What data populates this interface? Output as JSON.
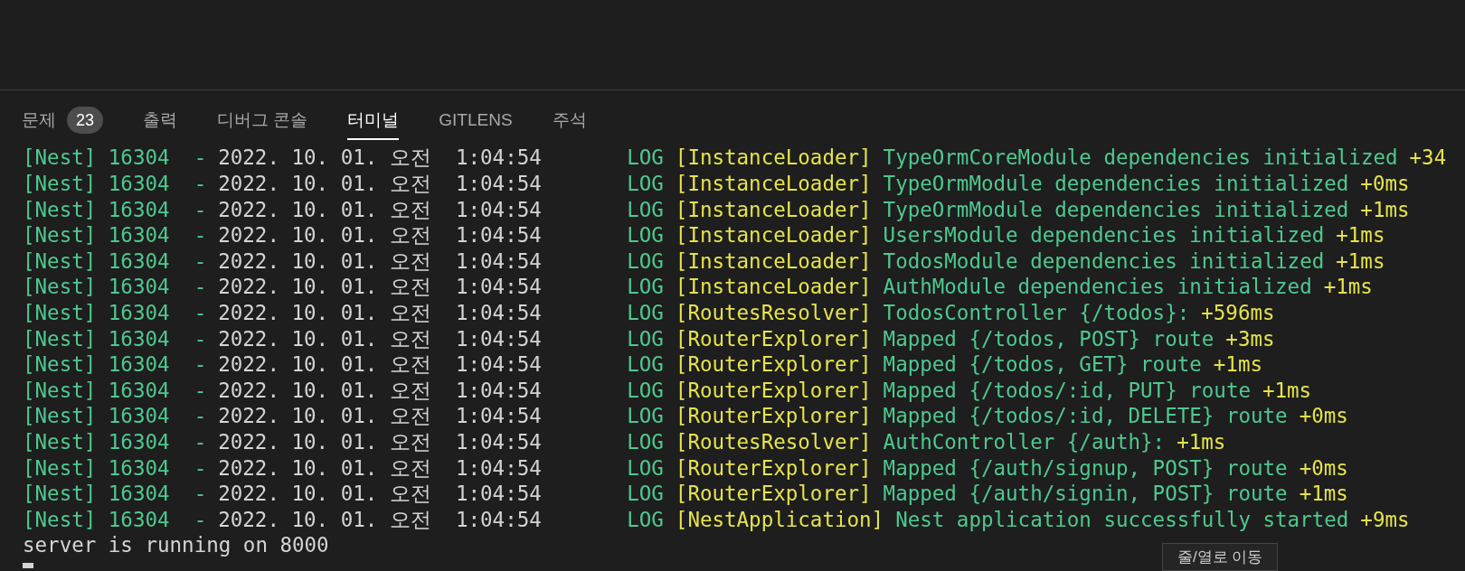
{
  "panel": {
    "tabs": [
      {
        "label": "문제",
        "badge": "23",
        "selected": false
      },
      {
        "label": "출력",
        "selected": false
      },
      {
        "label": "디버그 콘솔",
        "selected": false
      },
      {
        "label": "터미널",
        "selected": true
      },
      {
        "label": "GITLENS",
        "selected": false
      },
      {
        "label": "주석",
        "selected": false
      }
    ]
  },
  "terminal": {
    "lines": [
      {
        "kind": "log",
        "source": "[Nest] 16304  -",
        "timestamp": "2022. 10. 01. 오전  1:04:54",
        "log_level": "LOG",
        "context": "[InstanceLoader]",
        "message": "TypeOrmCoreModule dependencies initialized",
        "elapsed": "+34"
      },
      {
        "kind": "log",
        "source": "[Nest] 16304  -",
        "timestamp": "2022. 10. 01. 오전  1:04:54",
        "log_level": "LOG",
        "context": "[InstanceLoader]",
        "message": "TypeOrmModule dependencies initialized",
        "elapsed": "+0ms"
      },
      {
        "kind": "log",
        "source": "[Nest] 16304  -",
        "timestamp": "2022. 10. 01. 오전  1:04:54",
        "log_level": "LOG",
        "context": "[InstanceLoader]",
        "message": "TypeOrmModule dependencies initialized",
        "elapsed": "+1ms"
      },
      {
        "kind": "log",
        "source": "[Nest] 16304  -",
        "timestamp": "2022. 10. 01. 오전  1:04:54",
        "log_level": "LOG",
        "context": "[InstanceLoader]",
        "message": "UsersModule dependencies initialized",
        "elapsed": "+1ms"
      },
      {
        "kind": "log",
        "source": "[Nest] 16304  -",
        "timestamp": "2022. 10. 01. 오전  1:04:54",
        "log_level": "LOG",
        "context": "[InstanceLoader]",
        "message": "TodosModule dependencies initialized",
        "elapsed": "+1ms"
      },
      {
        "kind": "log",
        "source": "[Nest] 16304  -",
        "timestamp": "2022. 10. 01. 오전  1:04:54",
        "log_level": "LOG",
        "context": "[InstanceLoader]",
        "message": "AuthModule dependencies initialized",
        "elapsed": "+1ms"
      },
      {
        "kind": "log",
        "source": "[Nest] 16304  -",
        "timestamp": "2022. 10. 01. 오전  1:04:54",
        "log_level": "LOG",
        "context": "[RoutesResolver]",
        "message": "TodosController {/todos}:",
        "elapsed": "+596ms"
      },
      {
        "kind": "log",
        "source": "[Nest] 16304  -",
        "timestamp": "2022. 10. 01. 오전  1:04:54",
        "log_level": "LOG",
        "context": "[RouterExplorer]",
        "message": "Mapped {/todos, POST} route",
        "elapsed": "+3ms"
      },
      {
        "kind": "log",
        "source": "[Nest] 16304  -",
        "timestamp": "2022. 10. 01. 오전  1:04:54",
        "log_level": "LOG",
        "context": "[RouterExplorer]",
        "message": "Mapped {/todos, GET} route",
        "elapsed": "+1ms"
      },
      {
        "kind": "log",
        "source": "[Nest] 16304  -",
        "timestamp": "2022. 10. 01. 오전  1:04:54",
        "log_level": "LOG",
        "context": "[RouterExplorer]",
        "message": "Mapped {/todos/:id, PUT} route",
        "elapsed": "+1ms"
      },
      {
        "kind": "log",
        "source": "[Nest] 16304  -",
        "timestamp": "2022. 10. 01. 오전  1:04:54",
        "log_level": "LOG",
        "context": "[RouterExplorer]",
        "message": "Mapped {/todos/:id, DELETE} route",
        "elapsed": "+0ms"
      },
      {
        "kind": "log",
        "source": "[Nest] 16304  -",
        "timestamp": "2022. 10. 01. 오전  1:04:54",
        "log_level": "LOG",
        "context": "[RoutesResolver]",
        "message": "AuthController {/auth}:",
        "elapsed": "+1ms"
      },
      {
        "kind": "log",
        "source": "[Nest] 16304  -",
        "timestamp": "2022. 10. 01. 오전  1:04:54",
        "log_level": "LOG",
        "context": "[RouterExplorer]",
        "message": "Mapped {/auth/signup, POST} route",
        "elapsed": "+0ms"
      },
      {
        "kind": "log",
        "source": "[Nest] 16304  -",
        "timestamp": "2022. 10. 01. 오전  1:04:54",
        "log_level": "LOG",
        "context": "[RouterExplorer]",
        "message": "Mapped {/auth/signin, POST} route",
        "elapsed": "+1ms"
      },
      {
        "kind": "log",
        "source": "[Nest] 16304  -",
        "timestamp": "2022. 10. 01. 오전  1:04:54",
        "log_level": "LOG",
        "context": "[NestApplication]",
        "message": "Nest application successfully started",
        "elapsed": "+9ms"
      },
      {
        "kind": "plain",
        "text": "server is running on 8000"
      }
    ]
  },
  "tooltip": {
    "text": "줄/열로 이동"
  }
}
